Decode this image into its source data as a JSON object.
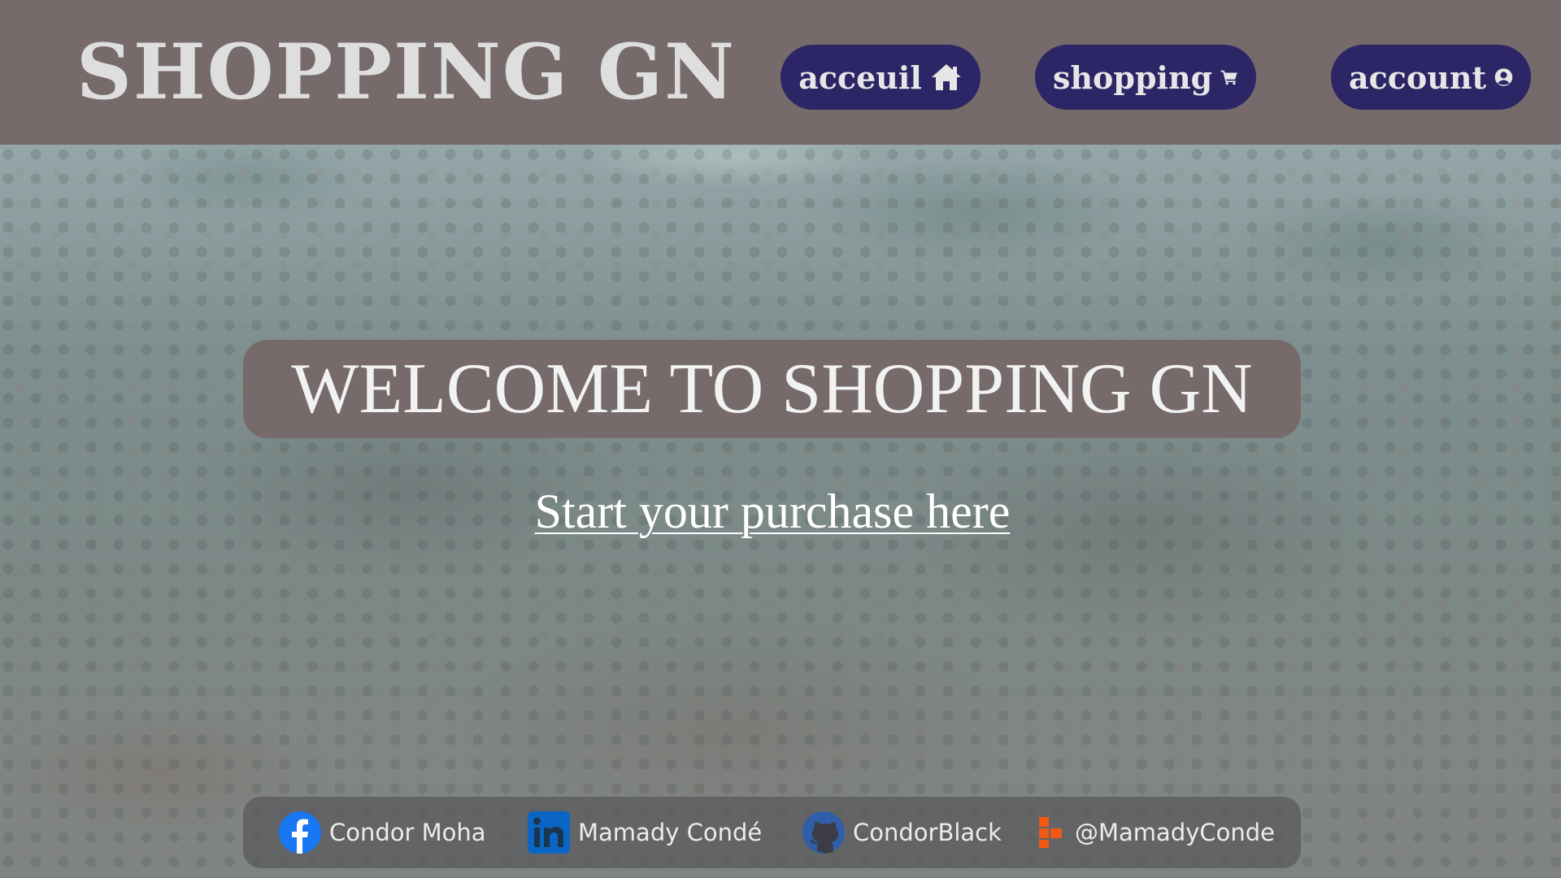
{
  "header": {
    "brand": "SHOPPING GN",
    "nav": {
      "home_label": "acceuil",
      "shopping_label": "shopping",
      "account_label": "account"
    }
  },
  "hero": {
    "welcome": "WELCOME TO SHOPPING GN",
    "cta": "Start your purchase here"
  },
  "footer": {
    "facebook": "Condor Moha",
    "linkedin": "Mamady Condé",
    "github": "CondorBlack",
    "other": "@MamadyConde"
  },
  "colors": {
    "header_bg": "#766a6b",
    "nav_button_bg": "#2c2566",
    "facebook": "#1877f2",
    "linkedin": "#0a66c2",
    "github": "#2f5fa8",
    "other": "#f25a14"
  },
  "icons": [
    "home-icon",
    "cart-icon",
    "user-circle-icon",
    "facebook-icon",
    "linkedin-icon",
    "github-icon",
    "brand-icon"
  ]
}
